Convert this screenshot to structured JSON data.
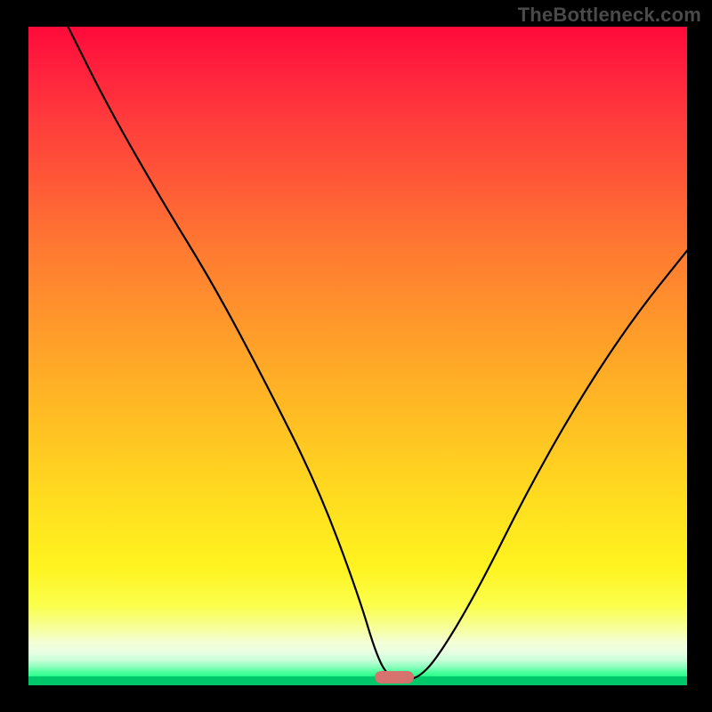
{
  "watermark": "TheBottleneck.com",
  "colors": {
    "frame_bg": "#000000",
    "watermark": "#4a4a4a",
    "curve": "#000000",
    "marker": "#d6736f",
    "gradient_top": "#ff0a3a",
    "gradient_mid": "#ffdd1f",
    "gradient_bottom": "#00c76a"
  },
  "marker": {
    "x_frac": 0.555,
    "y_frac": 0.988
  },
  "chart_data": {
    "type": "line",
    "title": "",
    "xlabel": "",
    "ylabel": "",
    "xlim": [
      0,
      100
    ],
    "ylim": [
      0,
      100
    ],
    "series": [
      {
        "name": "bottleneck-curve",
        "x": [
          6,
          12,
          20,
          28,
          36,
          44,
          50,
          53,
          55,
          57,
          59,
          62,
          68,
          76,
          84,
          92,
          100
        ],
        "y": [
          100,
          88,
          74,
          61,
          46,
          30,
          14,
          4,
          1,
          1,
          1,
          4,
          14,
          30,
          44,
          56,
          66
        ]
      }
    ],
    "annotations": [
      {
        "name": "optimal-marker",
        "x": 56,
        "y": 1
      }
    ],
    "background": "vertical-heatmap red→yellow→green"
  }
}
